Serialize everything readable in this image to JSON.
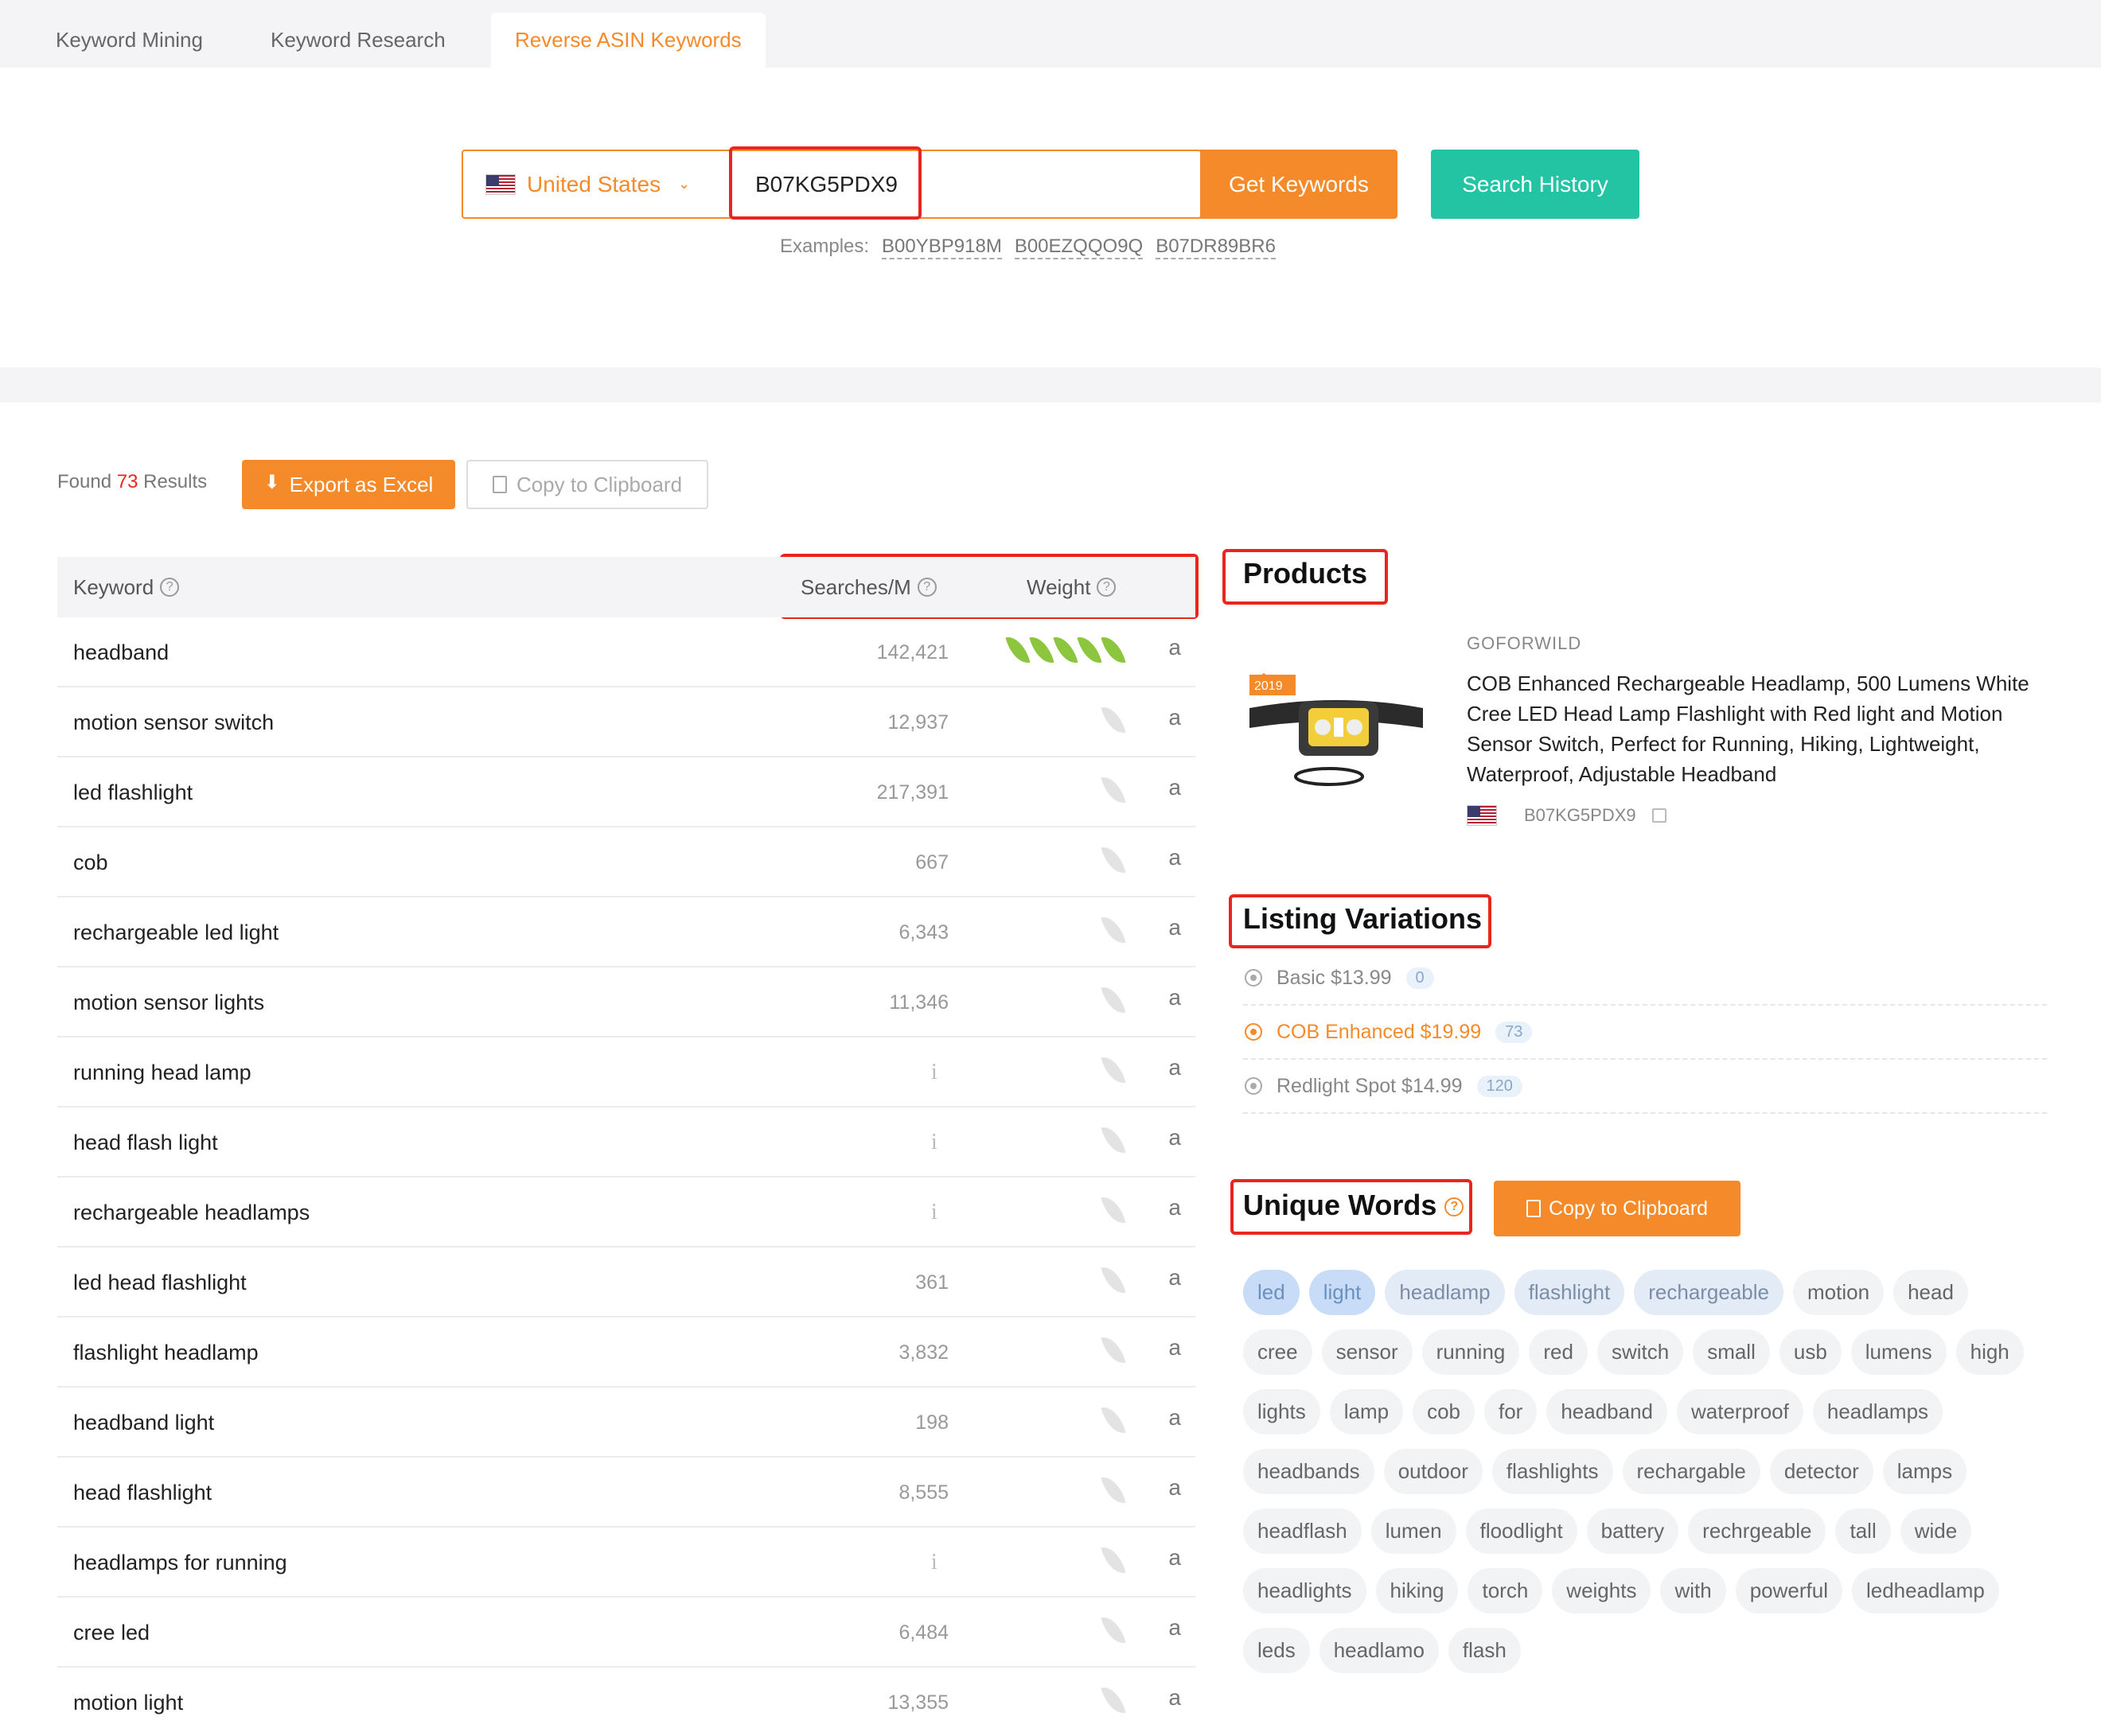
{
  "tabs": [
    {
      "label": "Keyword Mining"
    },
    {
      "label": "Keyword Research"
    },
    {
      "label": "Reverse ASIN Keywords"
    }
  ],
  "search": {
    "country": "United States",
    "asin_value": "B07KG5PDX9",
    "get_keywords_label": "Get Keywords",
    "search_history_label": "Search History",
    "examples_label": "Examples:",
    "examples": [
      "B00YBP918M",
      "B00EZQQO9Q",
      "B07DR89BR6"
    ]
  },
  "results": {
    "found_prefix": "Found",
    "count": "73",
    "found_suffix": "Results",
    "export_label": "Export as Excel",
    "copy_label": "Copy to Clipboard"
  },
  "table": {
    "headers": {
      "keyword": "Keyword",
      "searches": "Searches/M",
      "weight": "Weight"
    },
    "rows": [
      {
        "keyword": "headband",
        "searches": "142,421",
        "weight": 5
      },
      {
        "keyword": "motion sensor switch",
        "searches": "12,937",
        "weight": 0
      },
      {
        "keyword": "led flashlight",
        "searches": "217,391",
        "weight": 0
      },
      {
        "keyword": "cob",
        "searches": "667",
        "weight": 0
      },
      {
        "keyword": "rechargeable led light",
        "searches": "6,343",
        "weight": 0
      },
      {
        "keyword": "motion sensor lights",
        "searches": "11,346",
        "weight": 0
      },
      {
        "keyword": "running head lamp",
        "searches": "",
        "weight": 0
      },
      {
        "keyword": "head flash light",
        "searches": "",
        "weight": 0
      },
      {
        "keyword": "rechargeable headlamps",
        "searches": "",
        "weight": 0
      },
      {
        "keyword": "led head flashlight",
        "searches": "361",
        "weight": 0
      },
      {
        "keyword": "flashlight headlamp",
        "searches": "3,832",
        "weight": 0
      },
      {
        "keyword": "headband light",
        "searches": "198",
        "weight": 0
      },
      {
        "keyword": "head flashlight",
        "searches": "8,555",
        "weight": 0
      },
      {
        "keyword": "headlamps for running",
        "searches": "",
        "weight": 0
      },
      {
        "keyword": "cree led",
        "searches": "6,484",
        "weight": 0
      },
      {
        "keyword": "motion light",
        "searches": "13,355",
        "weight": 0
      }
    ]
  },
  "products": {
    "title": "Products",
    "brand": "GOFORWILD",
    "product_title": "COB Enhanced Rechargeable Headlamp, 500 Lumens White Cree LED Head Lamp Flashlight with Red light and Motion Sensor Switch, Perfect for Running, Hiking, Lightweight, Waterproof, Adjustable Headband",
    "asin": "B07KG5PDX9",
    "badge_year": "2019"
  },
  "variations": {
    "title": "Listing Variations",
    "items": [
      {
        "label": "Basic $13.99",
        "count": "0",
        "selected": false
      },
      {
        "label": "COB Enhanced $19.99",
        "count": "73",
        "selected": true
      },
      {
        "label": "Redlight Spot $14.99",
        "count": "120",
        "selected": false
      }
    ]
  },
  "unique_words": {
    "title": "Unique Words",
    "copy_label": "Copy to Clipboard",
    "words": [
      "led",
      "light",
      "headlamp",
      "flashlight",
      "rechargeable",
      "motion",
      "head",
      "cree",
      "sensor",
      "running",
      "red",
      "switch",
      "small",
      "usb",
      "lumens",
      "high",
      "lights",
      "lamp",
      "cob",
      "for",
      "headband",
      "waterproof",
      "headlamps",
      "headbands",
      "outdoor",
      "flashlights",
      "rechargable",
      "detector",
      "lamps",
      "headflash",
      "lumen",
      "floodlight",
      "battery",
      "rechrgeable",
      "tall",
      "wide",
      "headlights",
      "hiking",
      "torch",
      "weights",
      "with",
      "powerful",
      "ledheadlamp",
      "leds",
      "headlamo",
      "flash"
    ],
    "highlight_strong": 2,
    "highlight_mid": 4
  },
  "colors": {
    "accent": "#f58a2a",
    "teal": "#22c4a4",
    "annotation_red": "#e8261d",
    "leaf_green": "#8cc63f"
  }
}
